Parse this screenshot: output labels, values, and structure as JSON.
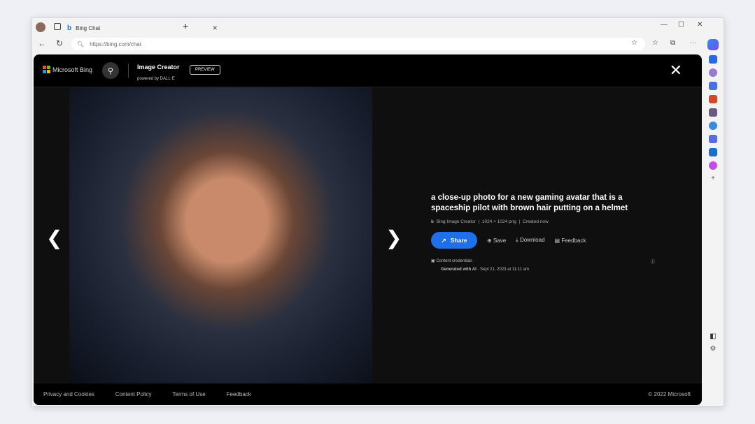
{
  "browser": {
    "tab_title": "Bing Chat",
    "url": "https://bing.com/chat"
  },
  "header": {
    "brand": "Microsoft Bing",
    "app_title": "Image Creator",
    "powered_by": "powered by DALL·E",
    "badge": "PREVIEW"
  },
  "image": {
    "prompt": "a close-up photo for a new gaming avatar that is a spaceship pilot with brown hair putting on a helmet",
    "source": "Bing Image Creator",
    "dimensions": "1024 × 1024 png",
    "created": "Created now"
  },
  "actions": {
    "share": "Share",
    "save": "Save",
    "download": "Download",
    "feedback": "Feedback"
  },
  "credentials": {
    "label": "Content credentials",
    "generated": "Generated with AI",
    "date": "Sept 21, 2023 at 11:11 am"
  },
  "footer": {
    "links": [
      "Privacy and Cookies",
      "Content Policy",
      "Terms of Use",
      "Feedback"
    ],
    "copyright": "© 2022 Microsoft"
  },
  "colors": {
    "accent": "#1f6fe8",
    "background": "#0f0f0f"
  }
}
